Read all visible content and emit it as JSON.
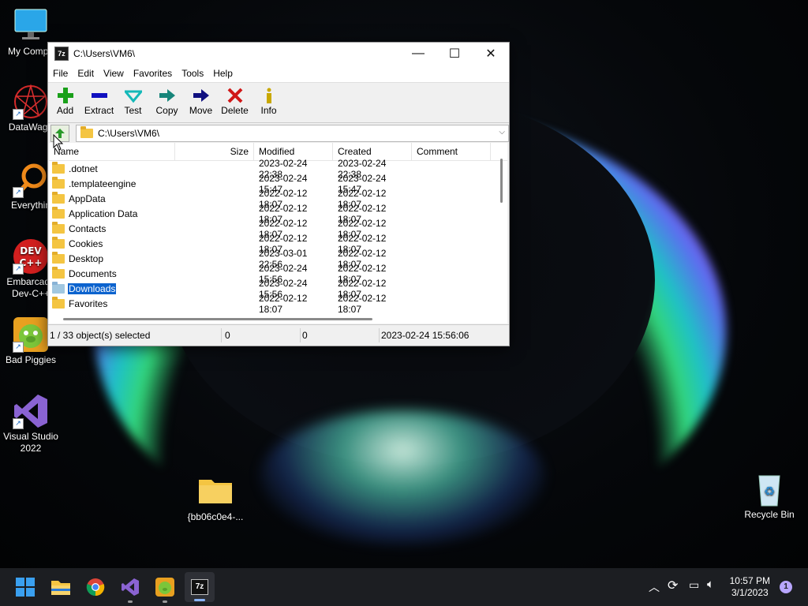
{
  "desktop": {
    "icons": [
      {
        "label": "My Compu",
        "name": "my-computer"
      },
      {
        "label": "DataWago",
        "name": "datawagon"
      },
      {
        "label": "Everythin",
        "name": "everything"
      },
      {
        "label": "Embarcade\nDev-C++",
        "name": "dev-cpp"
      },
      {
        "label": "Bad Piggies",
        "name": "bad-piggies"
      },
      {
        "label": "Visual Studio\n2022",
        "name": "visual-studio"
      },
      {
        "label": "{bb06c0e4-...",
        "name": "guid-folder"
      },
      {
        "label": "Recycle Bin",
        "name": "recycle-bin"
      }
    ]
  },
  "window": {
    "title": "C:\\Users\\VM6\\",
    "menu": [
      "File",
      "Edit",
      "View",
      "Favorites",
      "Tools",
      "Help"
    ],
    "toolbar": [
      {
        "label": "Add",
        "icon": "plus-icon",
        "color": "#1aa01a"
      },
      {
        "label": "Extract",
        "icon": "minus-icon",
        "color": "#1010c0"
      },
      {
        "label": "Test",
        "icon": "check-icon",
        "color": "#14b8b8"
      },
      {
        "label": "Copy",
        "icon": "copy-arrow-icon",
        "color": "#17857a"
      },
      {
        "label": "Move",
        "icon": "move-arrow-icon",
        "color": "#101080"
      },
      {
        "label": "Delete",
        "icon": "delete-x-icon",
        "color": "#d01818"
      },
      {
        "label": "Info",
        "icon": "info-icon",
        "color": "#c8a800"
      }
    ],
    "address": "C:\\Users\\VM6\\",
    "columns": {
      "name": "Name",
      "size": "Size",
      "modified": "Modified",
      "created": "Created",
      "comment": "Comment"
    },
    "rows": [
      {
        "name": ".dotnet",
        "modified": "2023-02-24 22:38",
        "created": "2023-02-24 22:38"
      },
      {
        "name": ".templateengine",
        "modified": "2023-02-24 15:47",
        "created": "2023-02-24 15:47"
      },
      {
        "name": "AppData",
        "modified": "2022-02-12 18:07",
        "created": "2022-02-12 18:07"
      },
      {
        "name": "Application Data",
        "modified": "2022-02-12 18:07",
        "created": "2022-02-12 18:07"
      },
      {
        "name": "Contacts",
        "modified": "2022-02-12 18:07",
        "created": "2022-02-12 18:07"
      },
      {
        "name": "Cookies",
        "modified": "2022-02-12 18:07",
        "created": "2022-02-12 18:07"
      },
      {
        "name": "Desktop",
        "modified": "2023-03-01 22:56",
        "created": "2022-02-12 18:07"
      },
      {
        "name": "Documents",
        "modified": "2023-02-24 15:56",
        "created": "2022-02-12 18:07"
      },
      {
        "name": "Downloads",
        "modified": "2023-02-24 15:56",
        "created": "2022-02-12 18:07",
        "selected": true
      },
      {
        "name": "Favorites",
        "modified": "2022-02-12 18:07",
        "created": "2022-02-12 18:07"
      }
    ],
    "status": {
      "selection": "1 / 33 object(s) selected",
      "size": "0",
      "packed": "0",
      "date": "2023-02-24 15:56:06"
    }
  },
  "taskbar": {
    "apps": [
      "start-icon",
      "file-explorer-icon",
      "chrome-icon",
      "visual-studio-icon",
      "bad-piggies-icon",
      "7zip-icon"
    ],
    "clock_time": "10:57 PM",
    "clock_date": "3/1/2023",
    "notification_count": "1"
  },
  "colors": {
    "selection": "#0c63ce",
    "folder": "#f4c542",
    "taskbar": "#1c1e22"
  }
}
